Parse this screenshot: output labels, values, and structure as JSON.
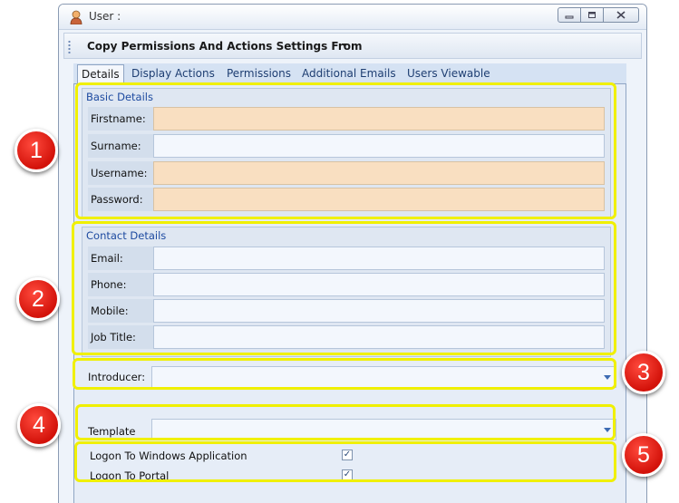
{
  "window": {
    "title": "User :"
  },
  "toolbar": {
    "copy_label": "Copy Permissions And Actions Settings From"
  },
  "tabs": [
    "Details",
    "Display Actions",
    "Permissions",
    "Additional Emails",
    "Users Viewable"
  ],
  "basic": {
    "title": "Basic Details",
    "fields": [
      {
        "label": "Firstname:",
        "value": ""
      },
      {
        "label": "Surname:",
        "value": ""
      },
      {
        "label": "Username:",
        "value": ""
      },
      {
        "label": "Password:",
        "value": ""
      }
    ]
  },
  "contact": {
    "title": "Contact Details",
    "fields": [
      {
        "label": "Email:",
        "value": ""
      },
      {
        "label": "Phone:",
        "value": ""
      },
      {
        "label": "Mobile:",
        "value": ""
      },
      {
        "label": "Job Title:",
        "value": ""
      }
    ]
  },
  "introducer": {
    "label": "Introducer:",
    "value": ""
  },
  "template": {
    "label": "Template",
    "value": ""
  },
  "logon": {
    "windows_label": "Logon To Windows Application",
    "windows_checked": "✓",
    "portal_label": "Logon To Portal",
    "portal_checked": "✓"
  },
  "callouts": [
    "1",
    "2",
    "3",
    "4",
    "5"
  ],
  "colors": {
    "highlight": "#f0f000",
    "badge": "#e01a10",
    "required_field": "#f9dfc1"
  }
}
